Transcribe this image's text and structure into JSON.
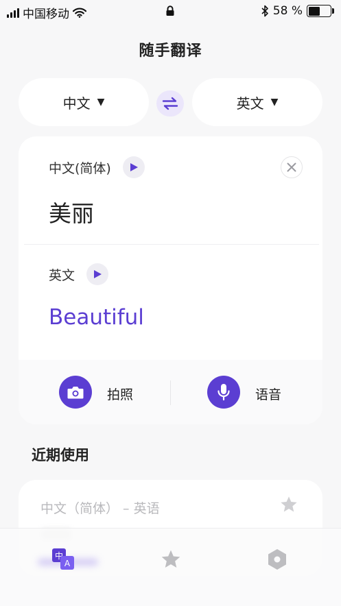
{
  "status_bar": {
    "carrier": "中国移动",
    "battery_percent": "58 %",
    "battery_level": 0.58
  },
  "app": {
    "title": "随手翻译"
  },
  "language_picker": {
    "source": "中文",
    "target": "英文",
    "caret": "▼"
  },
  "translation": {
    "source_label": "中文(简体)",
    "source_text": "美丽",
    "target_label": "英文",
    "target_text": "Beautiful"
  },
  "actions": {
    "photo_label": "拍照",
    "voice_label": "语音"
  },
  "recent": {
    "section_title": "近期使用",
    "items": [
      {
        "pair": "中文（简体） – 英语"
      }
    ]
  },
  "tabs": [
    {
      "icon": "translate-icon",
      "active": true
    },
    {
      "icon": "star-icon",
      "active": false
    },
    {
      "icon": "hexagon-settings-icon",
      "active": false
    }
  ],
  "colors": {
    "accent": "#5b3ed2",
    "accent_light": "#ebe6fb",
    "background": "#f7f7f8",
    "muted_text": "#b9b9bc",
    "inactive_icon": "#bdbdc0"
  }
}
